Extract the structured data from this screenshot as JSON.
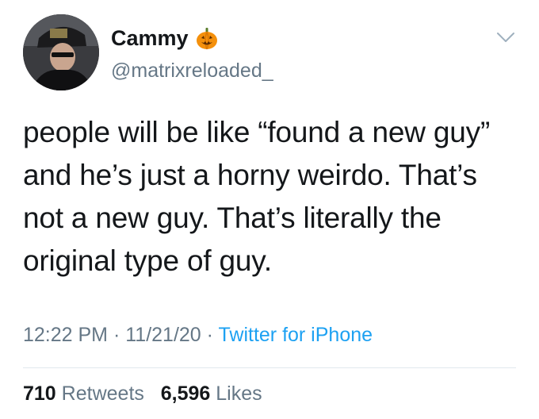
{
  "user": {
    "display_name": "Cammy",
    "handle": "@matrixreloaded_",
    "name_emoji_icon": "jack-o-lantern-icon",
    "avatar_icon": "profile-photo"
  },
  "tweet": {
    "lines": [
      "people will be like “found a new guy”",
      "and he’s just a horny weirdo. That’s",
      "not a new guy. That’s literally the",
      "original type of guy."
    ]
  },
  "meta": {
    "time": "12:22 PM",
    "separator": "·",
    "date": "11/21/20",
    "source": "Twitter for iPhone"
  },
  "stats": {
    "retweets_count": "710",
    "retweets_label": "Retweets",
    "likes_count": "6,596",
    "likes_label": "Likes"
  },
  "colors": {
    "text": "#14171a",
    "secondary": "#657786",
    "link": "#1da1f2",
    "divider": "#e1e8ed"
  },
  "icons": {
    "menu": "chevron-down-icon"
  }
}
